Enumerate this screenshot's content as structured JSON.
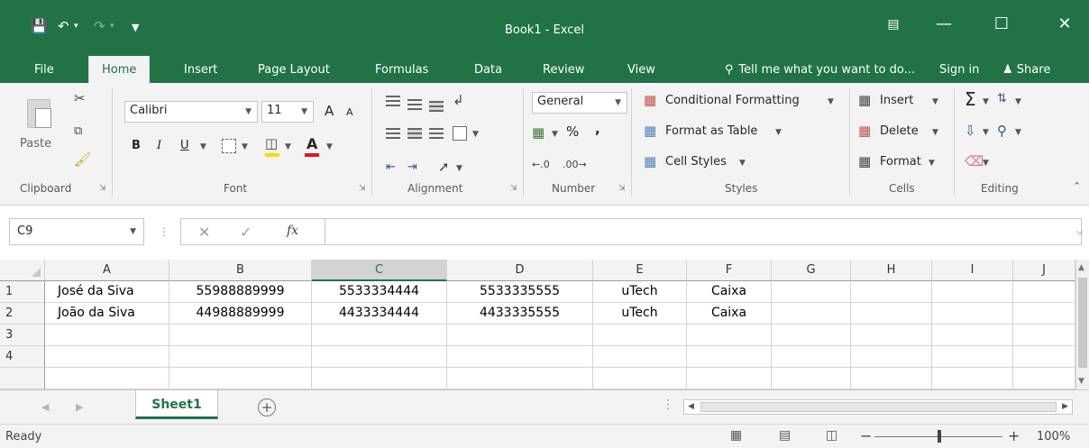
{
  "window": {
    "title": "Book1 - Excel",
    "qat": {
      "save_icon": "save-icon",
      "undo_icon": "undo-icon",
      "redo_icon": "redo-icon"
    },
    "ribbon_display_icon": "ribbon-display-icon"
  },
  "tabs": [
    "File",
    "Home",
    "Insert",
    "Page Layout",
    "Formulas",
    "Data",
    "Review",
    "View"
  ],
  "tell_me": "Tell me what you want to do...",
  "sign_in": "Sign in",
  "share": "Share",
  "ribbon": {
    "clipboard": {
      "paste": "Paste",
      "label": "Clipboard"
    },
    "font": {
      "name": "Calibri",
      "size": "11",
      "bold": "B",
      "italic": "I",
      "underline": "U",
      "grow": "A",
      "shrink": "A",
      "font_color": "A",
      "label": "Font"
    },
    "alignment": {
      "label": "Alignment"
    },
    "number": {
      "format": "General",
      "percent": "%",
      "comma": ",",
      "label": "Number"
    },
    "styles": {
      "conditional": "Conditional Formatting",
      "format_table": "Format as Table",
      "cell_styles": "Cell Styles",
      "label": "Styles"
    },
    "cells": {
      "insert": "Insert",
      "delete": "Delete",
      "format": "Format",
      "label": "Cells"
    },
    "editing": {
      "sum": "Σ",
      "label": "Editing"
    }
  },
  "formula_bar": {
    "name_box": "C9",
    "fx": "fx",
    "formula": ""
  },
  "columns": [
    "A",
    "B",
    "C",
    "D",
    "E",
    "F",
    "G",
    "H",
    "I",
    "J"
  ],
  "selected_column": "C",
  "rows": [
    {
      "num": "1",
      "cells": [
        "José da Siva",
        "55988889999",
        "5533334444",
        "5533335555",
        "uTech",
        "Caixa",
        "",
        "",
        "",
        ""
      ]
    },
    {
      "num": "2",
      "cells": [
        "João da Siva",
        "44988889999",
        "4433334444",
        "4433335555",
        "uTech",
        "Caixa",
        "",
        "",
        "",
        ""
      ]
    },
    {
      "num": "3",
      "cells": [
        "",
        "",
        "",
        "",
        "",
        "",
        "",
        "",
        "",
        ""
      ]
    },
    {
      "num": "4",
      "cells": [
        "",
        "",
        "",
        "",
        "",
        "",
        "",
        "",
        "",
        ""
      ]
    }
  ],
  "sheets": [
    "Sheet1"
  ],
  "status": {
    "ready": "Ready",
    "zoom": "100%"
  },
  "colors": {
    "excel_green": "#217346",
    "ribbon_bg": "#f3f3f3"
  }
}
